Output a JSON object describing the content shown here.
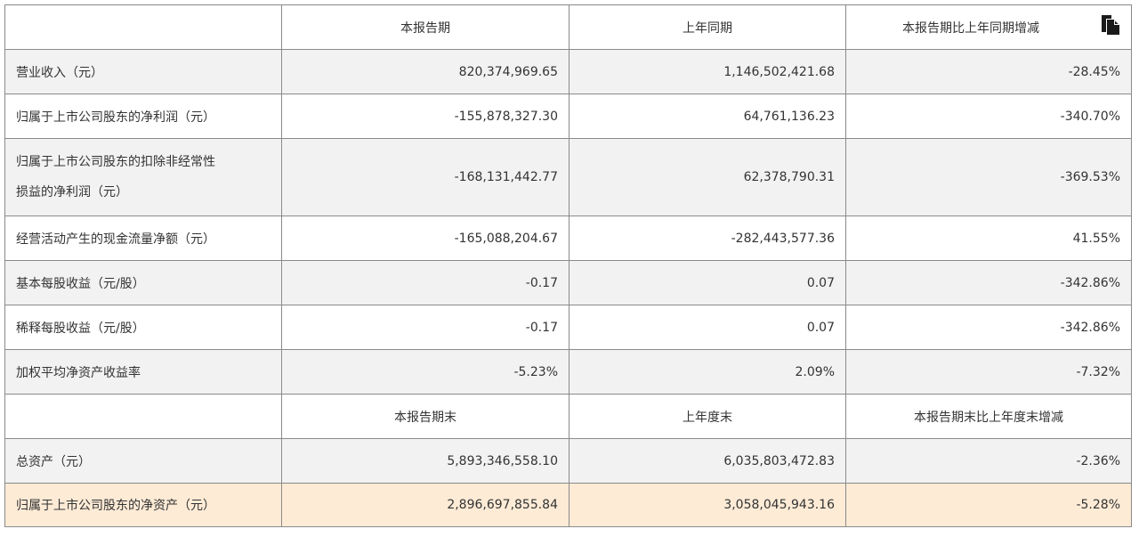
{
  "header1": {
    "col1": "本报告期",
    "col2": "上年同期",
    "col3": "本报告期比上年同期增减"
  },
  "rows1": [
    {
      "label": "营业收入（元）",
      "v1": "820,374,969.65",
      "v2": "1,146,502,421.68",
      "v3": "-28.45%"
    },
    {
      "label": "归属于上市公司股东的净利润（元）",
      "v1": "-155,878,327.30",
      "v2": "64,761,136.23",
      "v3": "-340.70%"
    },
    {
      "label_line1": "归属于上市公司股东的扣除非经常性",
      "label_line2": "损益的净利润（元）",
      "v1": "-168,131,442.77",
      "v2": "62,378,790.31",
      "v3": "-369.53%"
    },
    {
      "label": "经营活动产生的现金流量净额（元）",
      "v1": "-165,088,204.67",
      "v2": "-282,443,577.36",
      "v3": "41.55%"
    },
    {
      "label": "基本每股收益（元/股）",
      "v1": "-0.17",
      "v2": "0.07",
      "v3": "-342.86%"
    },
    {
      "label": "稀释每股收益（元/股）",
      "v1": "-0.17",
      "v2": "0.07",
      "v3": "-342.86%"
    },
    {
      "label": "加权平均净资产收益率",
      "v1": "-5.23%",
      "v2": "2.09%",
      "v3": "-7.32%"
    }
  ],
  "header2": {
    "col1": "本报告期末",
    "col2": "上年度末",
    "col3": "本报告期末比上年度末增减"
  },
  "rows2": [
    {
      "label": "总资产（元）",
      "v1": "5,893,346,558.10",
      "v2": "6,035,803,472.83",
      "v3": "-2.36%"
    },
    {
      "label": "归属于上市公司股东的净资产（元）",
      "v1": "2,896,697,855.84",
      "v2": "3,058,045,943.16",
      "v3": "-5.28%"
    }
  ],
  "icons": {
    "copy": "copy-icon"
  },
  "colors": {
    "border": "#8a8a8a",
    "row_shade": "#f2f2f2",
    "row_highlight": "#fdebd6",
    "text": "#333333"
  }
}
